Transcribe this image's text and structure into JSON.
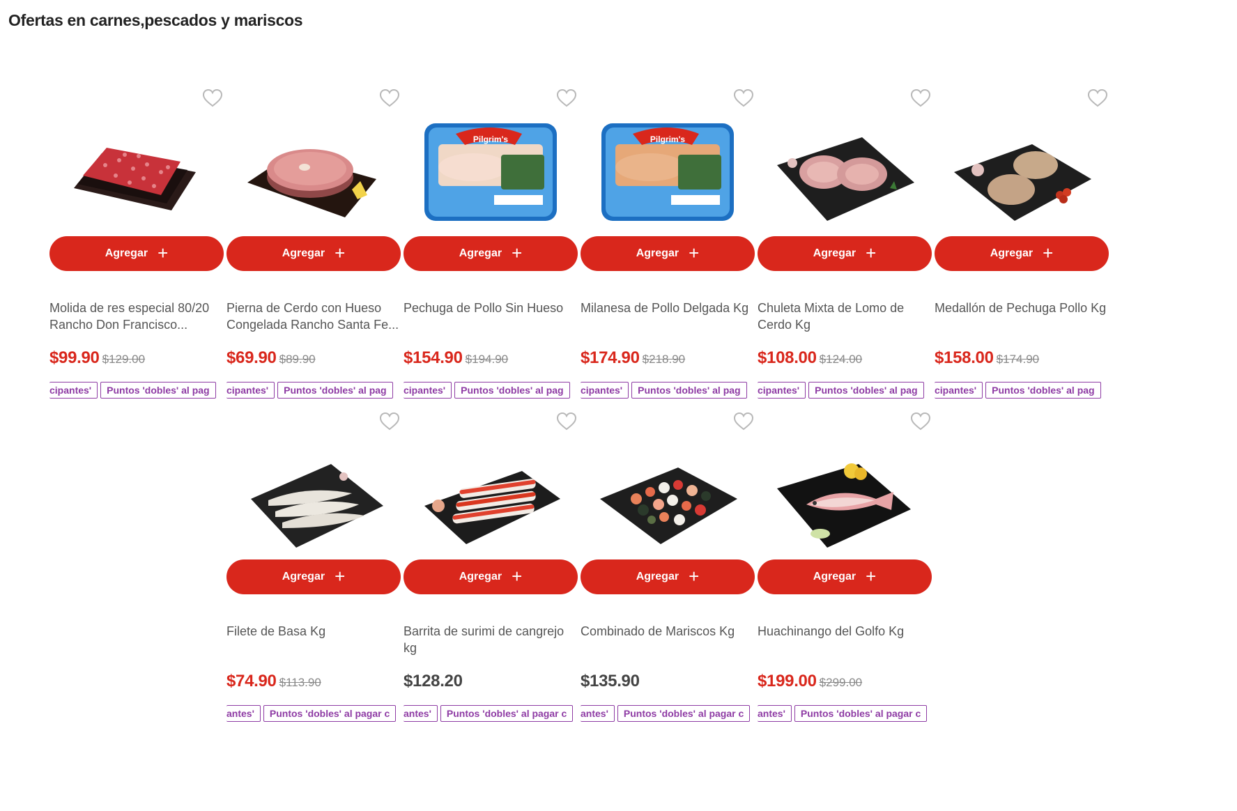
{
  "section": {
    "title": "Ofertas en carnes,pescados y mariscos"
  },
  "accent_color": "#d9271c",
  "promo_color": "#8e3ba4",
  "add_label": "Agregar",
  "favorite_icon": "heart-outline-icon",
  "products": [
    {
      "name": "Molida de res especial 80/20 Rancho Don Francisco...",
      "price": "$99.90",
      "old_price": "$129.00",
      "promo_a": "cipantes'",
      "promo_b": "Puntos 'dobles' al pag",
      "image": "ground-beef-on-board"
    },
    {
      "name": "Pierna de Cerdo con Hueso Congelada Rancho Santa Fe...",
      "price": "$69.90",
      "old_price": "$89.90",
      "promo_a": "cipantes'",
      "promo_b": "Puntos 'dobles' al pag",
      "image": "pork-leg-steak-on-board"
    },
    {
      "name": "Pechuga de Pollo Sin Hueso",
      "price": "$154.90",
      "old_price": "$194.90",
      "promo_a": "cipantes'",
      "promo_b": "Puntos 'dobles' al pag",
      "image": "pilgrims-chicken-breast-tray"
    },
    {
      "name": "Milanesa de Pollo Delgada Kg",
      "price": "$174.90",
      "old_price": "$218.90",
      "promo_a": "cipantes'",
      "promo_b": "Puntos 'dobles' al pag",
      "image": "pilgrims-chicken-milanesa-tray"
    },
    {
      "name": "Chuleta Mixta de Lomo de Cerdo Kg",
      "price": "$108.00",
      "old_price": "$124.00",
      "promo_a": "cipantes'",
      "promo_b": "Puntos 'dobles' al pag",
      "image": "pork-chops-on-board"
    },
    {
      "name": "Medallón de Pechuga Pollo Kg",
      "price": "$158.00",
      "old_price": "$174.90",
      "promo_a": "cipantes'",
      "promo_b": "Puntos 'dobles' al pag",
      "image": "chicken-medallions-on-board"
    },
    {
      "name": "Filete de Basa Kg",
      "price": "$74.90",
      "old_price": "$113.90",
      "promo_a": "antes'",
      "promo_b": "Puntos 'dobles' al pagar c",
      "image": "basa-fillets-on-board"
    },
    {
      "name": "Barrita de surimi de cangrejo kg",
      "price": "$128.20",
      "old_price": "",
      "promo_a": "antes'",
      "promo_b": "Puntos 'dobles' al pagar c",
      "image": "surimi-sticks-on-board"
    },
    {
      "name": "Combinado de Mariscos Kg",
      "price": "$135.90",
      "old_price": "",
      "promo_a": "antes'",
      "promo_b": "Puntos 'dobles' al pagar c",
      "image": "seafood-mix-on-board"
    },
    {
      "name": "Huachinango del Golfo Kg",
      "price": "$199.00",
      "old_price": "$299.00",
      "promo_a": "antes'",
      "promo_b": "Puntos 'dobles' al pagar c",
      "image": "red-snapper-on-board"
    }
  ]
}
